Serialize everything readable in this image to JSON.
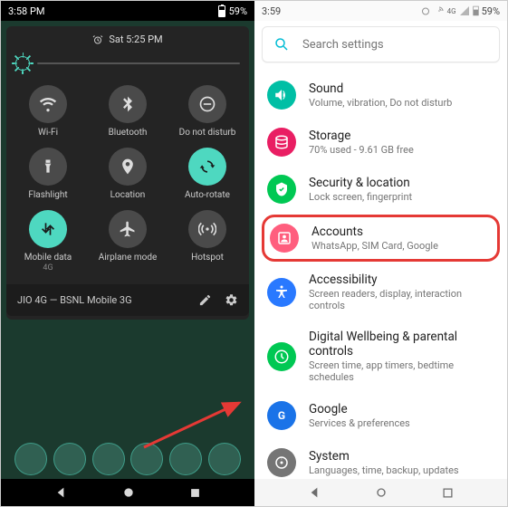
{
  "left": {
    "status": {
      "time": "3:58 PM",
      "battery": "59%"
    },
    "header": {
      "day_time": "Sat 5:25 PM"
    },
    "tiles": [
      {
        "id": "wifi",
        "label": "Wi-Fi",
        "on": false
      },
      {
        "id": "bluetooth",
        "label": "Bluetooth",
        "on": false
      },
      {
        "id": "dnd",
        "label": "Do not disturb",
        "on": false
      },
      {
        "id": "flashlight",
        "label": "Flashlight",
        "on": false
      },
      {
        "id": "location",
        "label": "Location",
        "on": false
      },
      {
        "id": "autorotate",
        "label": "Auto-rotate",
        "on": true
      },
      {
        "id": "mobiledata",
        "label": "Mobile data",
        "sub": "4G",
        "on": true
      },
      {
        "id": "airplane",
        "label": "Airplane mode",
        "on": false
      },
      {
        "id": "hotspot",
        "label": "Hotspot",
        "on": false
      }
    ],
    "footer": {
      "carrier": "JIO 4G — BSNL Mobile 3G"
    }
  },
  "right": {
    "status": {
      "time": "3:59",
      "battery": "59%"
    },
    "search": {
      "placeholder": "Search settings"
    },
    "items": [
      {
        "icon": "sound",
        "color": "#00bfa5",
        "title": "Sound",
        "sub": "Volume, vibration, Do not disturb"
      },
      {
        "icon": "storage",
        "color": "#e91e63",
        "title": "Storage",
        "sub": "70% used - 9.61 GB free"
      },
      {
        "icon": "security",
        "color": "#00c853",
        "title": "Security & location",
        "sub": "Lock screen, fingerprint"
      },
      {
        "icon": "accounts",
        "color": "#ff5e7e",
        "title": "Accounts",
        "sub": "WhatsApp, SIM Card, Google",
        "highlight": true
      },
      {
        "icon": "accessibility",
        "color": "#2979ff",
        "title": "Accessibility",
        "sub": "Screen readers, display, interaction controls"
      },
      {
        "icon": "wellbeing",
        "color": "#00c853",
        "title": "Digital Wellbeing & parental controls",
        "sub": "Screen time, app timers, bedtime schedules"
      },
      {
        "icon": "google",
        "color": "#1a73e8",
        "title": "Google",
        "sub": "Services & preferences"
      },
      {
        "icon": "system",
        "color": "#757575",
        "title": "System",
        "sub": "Languages, time, backup, updates"
      }
    ]
  }
}
